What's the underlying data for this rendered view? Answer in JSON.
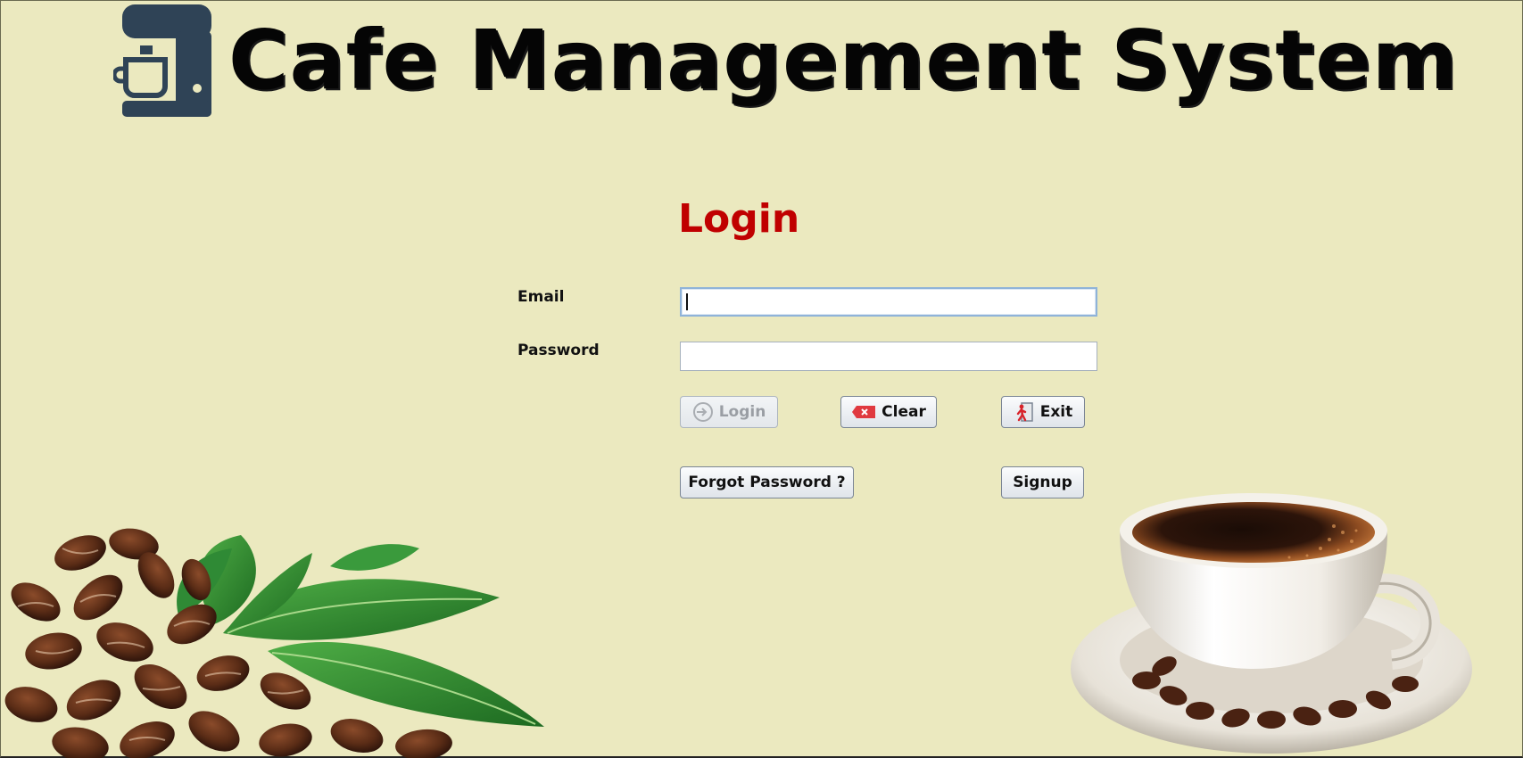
{
  "header": {
    "title": "Cafe Management System",
    "logo_icon": "coffee-machine-icon",
    "icon_color": "#2f4356"
  },
  "login_form": {
    "heading": "Login",
    "heading_color": "#c00000",
    "email_label": "Email",
    "email_value": "",
    "password_label": "Password",
    "password_value": "",
    "buttons": {
      "login": "Login",
      "clear": "Clear",
      "exit": "Exit",
      "forgot_password": "Forgot Password ?",
      "signup": "Signup"
    },
    "icons": {
      "login": "login-arrow-icon",
      "clear": "clear-x-icon",
      "exit": "exit-door-icon"
    }
  },
  "decor": {
    "left_image": "coffee-beans-and-leaves",
    "right_image": "coffee-cup-on-saucer"
  },
  "colors": {
    "background": "#ebe9bf",
    "title": "#050505"
  }
}
